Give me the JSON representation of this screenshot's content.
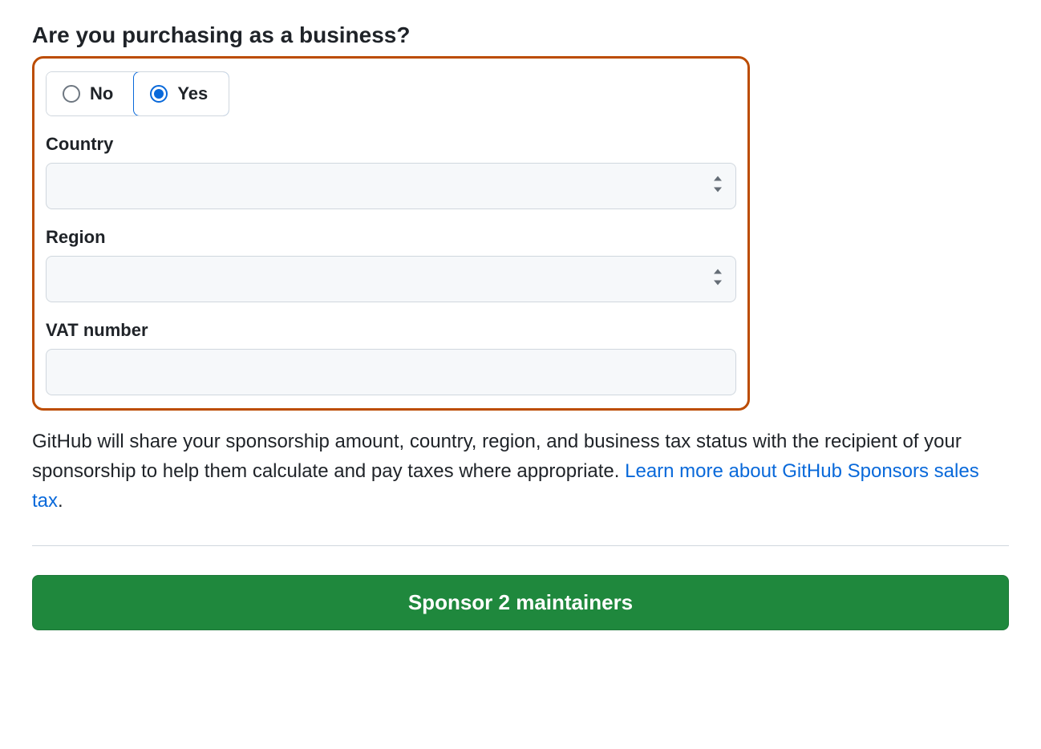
{
  "heading": "Are you purchasing as a business?",
  "options": {
    "no": "No",
    "yes": "Yes",
    "selected": "yes"
  },
  "fields": {
    "country": {
      "label": "Country",
      "value": ""
    },
    "region": {
      "label": "Region",
      "value": ""
    },
    "vat": {
      "label": "VAT number",
      "value": ""
    }
  },
  "disclosure": {
    "text": "GitHub will share your sponsorship amount, country, region, and business tax status with the recipient of your sponsorship to help them calculate and pay taxes where appropriate. ",
    "link_text": "Learn more about GitHub Sponsors sales tax",
    "period": "."
  },
  "submit_label": "Sponsor 2 maintainers",
  "colors": {
    "accent": "#0969da",
    "highlight_border": "#bc4c00",
    "primary_button": "#1f883d"
  }
}
